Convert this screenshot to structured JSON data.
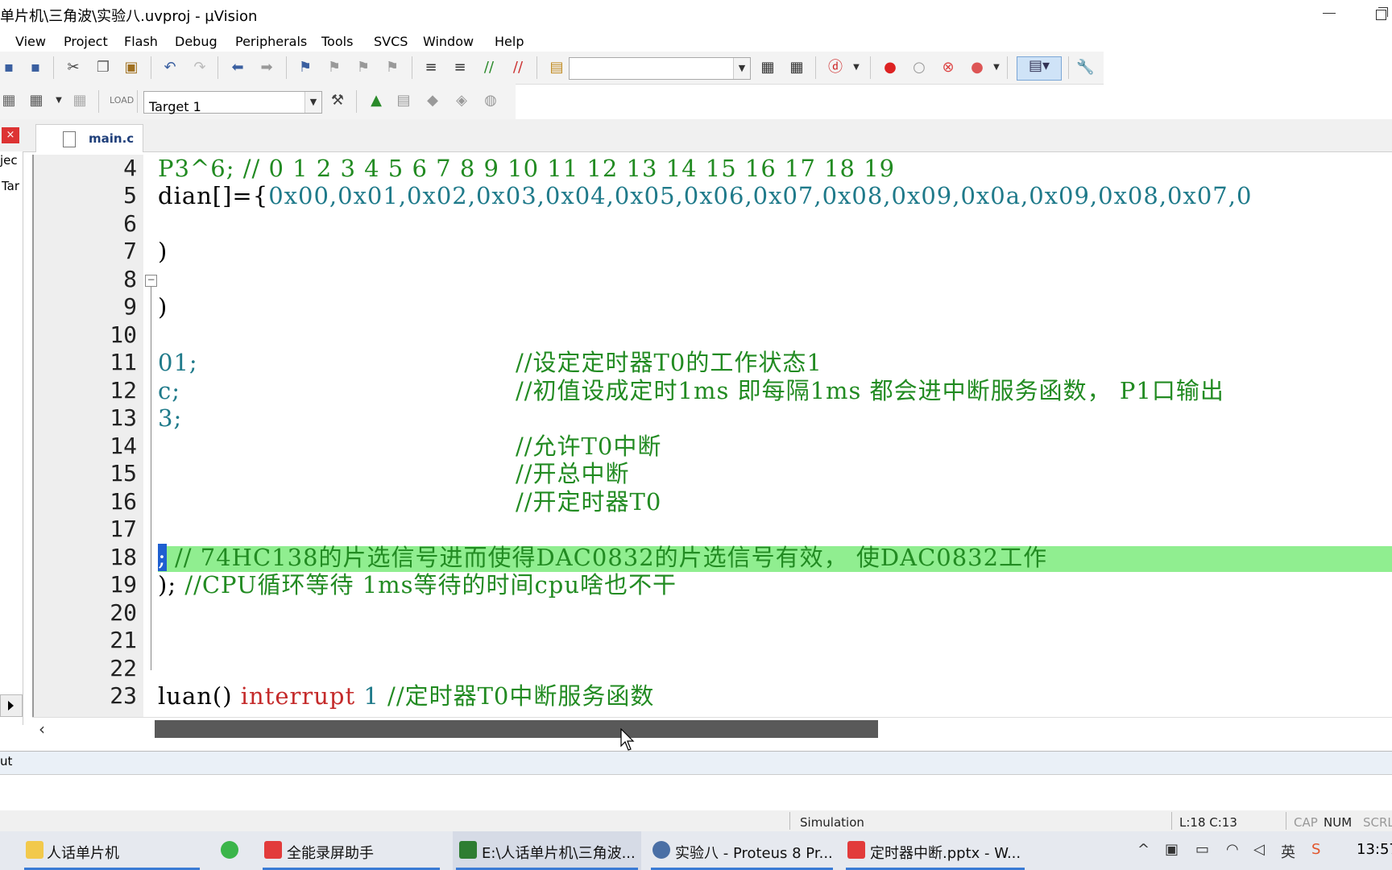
{
  "window": {
    "title": "单片机\\三角波\\实验八.uvproj - µVision"
  },
  "menu": [
    "View",
    "Project",
    "Flash",
    "Debug",
    "Peripherals",
    "Tools",
    "SVCS",
    "Window",
    "Help"
  ],
  "toolbar": {
    "target_name": "Target 1"
  },
  "tabs": {
    "active": "main.c"
  },
  "sidebar": {
    "label1": "jec",
    "label2": "Tar"
  },
  "editor": {
    "lines": [
      {
        "n": "4",
        "code": "P3^6;  // 0 1 2 3 4 5 6 7 8 9 10 11 12 13 14 15 16 17 18 19"
      },
      {
        "n": "5",
        "code_prefix": "dian[]={",
        "code_nums": "0x00,0x01,0x02,0x03,0x04,0x05,0x06,0x07,0x08,0x09,0x0a,0x09,0x08,0x07,0"
      },
      {
        "n": "6",
        "code": ""
      },
      {
        "n": "7",
        "code": ")"
      },
      {
        "n": "8",
        "code": ""
      },
      {
        "n": "9",
        "code": ")"
      },
      {
        "n": "10",
        "code": ""
      },
      {
        "n": "11",
        "code": "01;",
        "comment": "//设定定时器T0的工作状态1"
      },
      {
        "n": "12",
        "code": "c;",
        "comment": "//初值设成定时1ms 即每隔1ms 都会进中断服务函数， P1口输出"
      },
      {
        "n": "13",
        "code": "3;",
        "comment": ""
      },
      {
        "n": "14",
        "code": "",
        "comment": "//允许T0中断"
      },
      {
        "n": "15",
        "code": "",
        "comment": "//开总中断"
      },
      {
        "n": "16",
        "code": "",
        "comment": "//开定时器T0"
      },
      {
        "n": "17",
        "code": ""
      },
      {
        "n": "18",
        "code": ";",
        "comment": " // 74HC138的片选信号进而使得DAC0832的片选信号有效， 使DAC0832工作"
      },
      {
        "n": "19",
        "code": "); ",
        "comment": "//CPU循环等待 1ms等待的时间cpu啥也不干"
      },
      {
        "n": "20",
        "code": ""
      },
      {
        "n": "21",
        "code": ""
      },
      {
        "n": "22",
        "code": ""
      },
      {
        "n": "23",
        "code": "luan() ",
        "kw": "interrupt",
        "num": " 1",
        "comment": "  //定时器T0中断服务函数"
      }
    ]
  },
  "output": {
    "label": "ut"
  },
  "status": {
    "mode": "Simulation",
    "position": "L:18 C:13",
    "cap": "CAP",
    "num": "NUM",
    "scrl": "SCRL"
  },
  "taskbar": {
    "items": [
      "人话单片机",
      "全能录屏助手",
      "E:\\人话单片机\\三角波...",
      "实验八 - Proteus 8 Pr...",
      "定时器中断.pptx - W..."
    ],
    "clock": "13:57"
  },
  "colors": {
    "highlight": "#90ee90",
    "comment": "#228b22",
    "number": "#1f7a8a",
    "keyword": "#c42a2a"
  }
}
